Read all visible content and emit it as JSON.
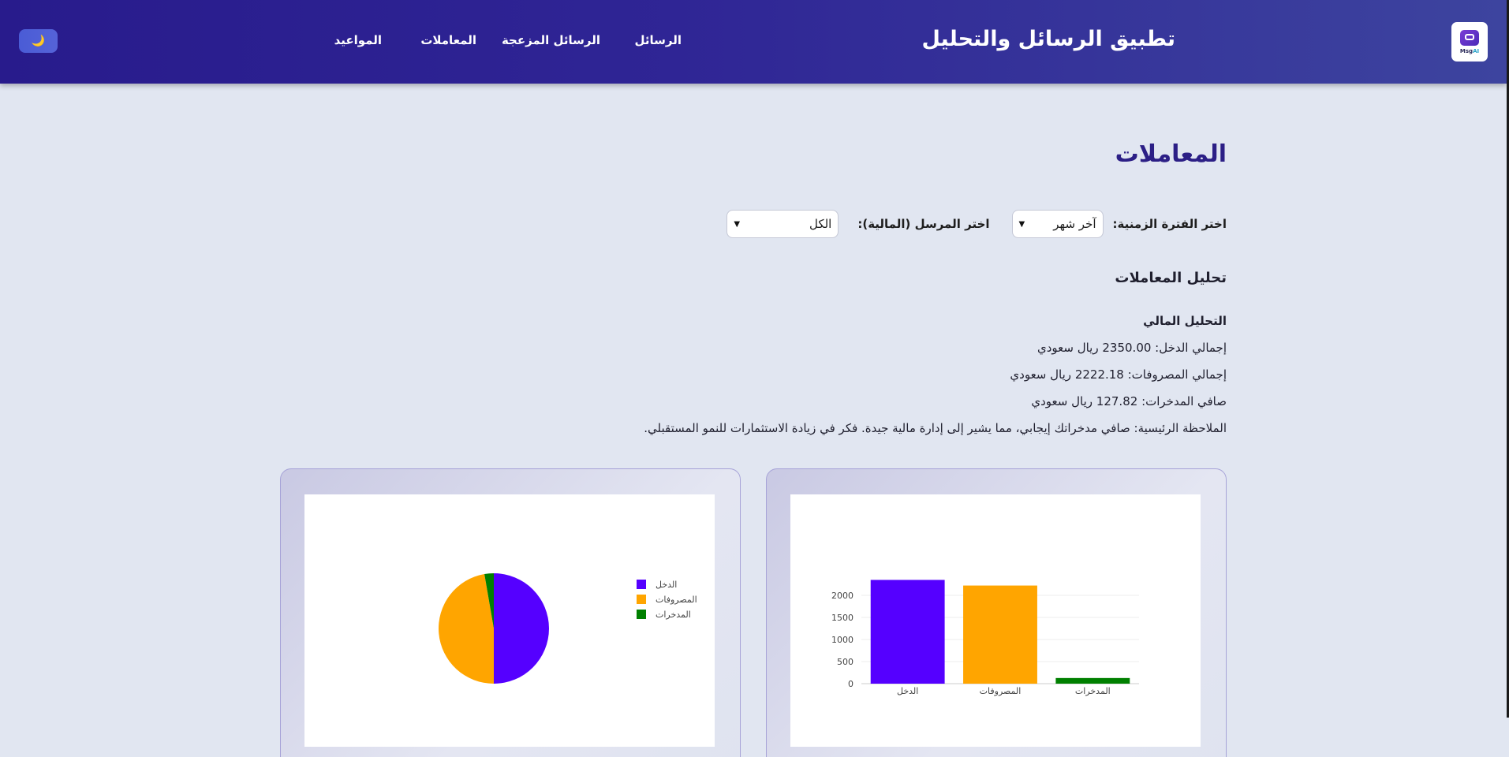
{
  "header": {
    "logo_text": "Msg",
    "logo_text_ai": "AI",
    "title": "تطبيق الرسائل والتحليل",
    "nav": [
      "الرسائل",
      "الرسائل المزعجة",
      "المعاملات",
      "المواعيد"
    ],
    "theme_icon": "moon-icon"
  },
  "page": {
    "title": "المعاملات",
    "filters": {
      "period_label": "اختر الفترة الزمنية:",
      "period_value": "آخر شهر",
      "sender_label": "اختر المرسل (المالية):",
      "sender_value": "الكل"
    },
    "analysis_title": "تحليل المعاملات",
    "financial": {
      "heading": "التحليل المالي",
      "income": "إجمالي الدخل: 2350.00 ريال سعودي",
      "expenses": "إجمالي المصروفات: 2222.18 ريال سعودي",
      "savings": "صافي المدخرات: 127.82 ريال سعودي",
      "note": "الملاحظة الرئيسية: صافي مدخراتك إيجابي، مما يشير إلى إدارة مالية جيدة. فكر في زيادة الاستثمارات للنمو المستقبلي."
    }
  },
  "colors": {
    "income": "#5500ff",
    "expenses": "#ffa500",
    "savings": "#008000"
  },
  "chart_data": [
    {
      "type": "bar",
      "categories": [
        "الدخل",
        "المصروفات",
        "المدخرات"
      ],
      "values": [
        2350,
        2222.18,
        127.82
      ],
      "ylim": [
        0,
        2500
      ],
      "yticks": [
        0,
        500,
        1000,
        1500,
        2000
      ],
      "grid": true
    },
    {
      "type": "pie",
      "labels": [
        "الدخل",
        "المصروفات",
        "المدخرات"
      ],
      "values": [
        2350,
        2222.18,
        127.82
      ],
      "legend": "right"
    }
  ]
}
